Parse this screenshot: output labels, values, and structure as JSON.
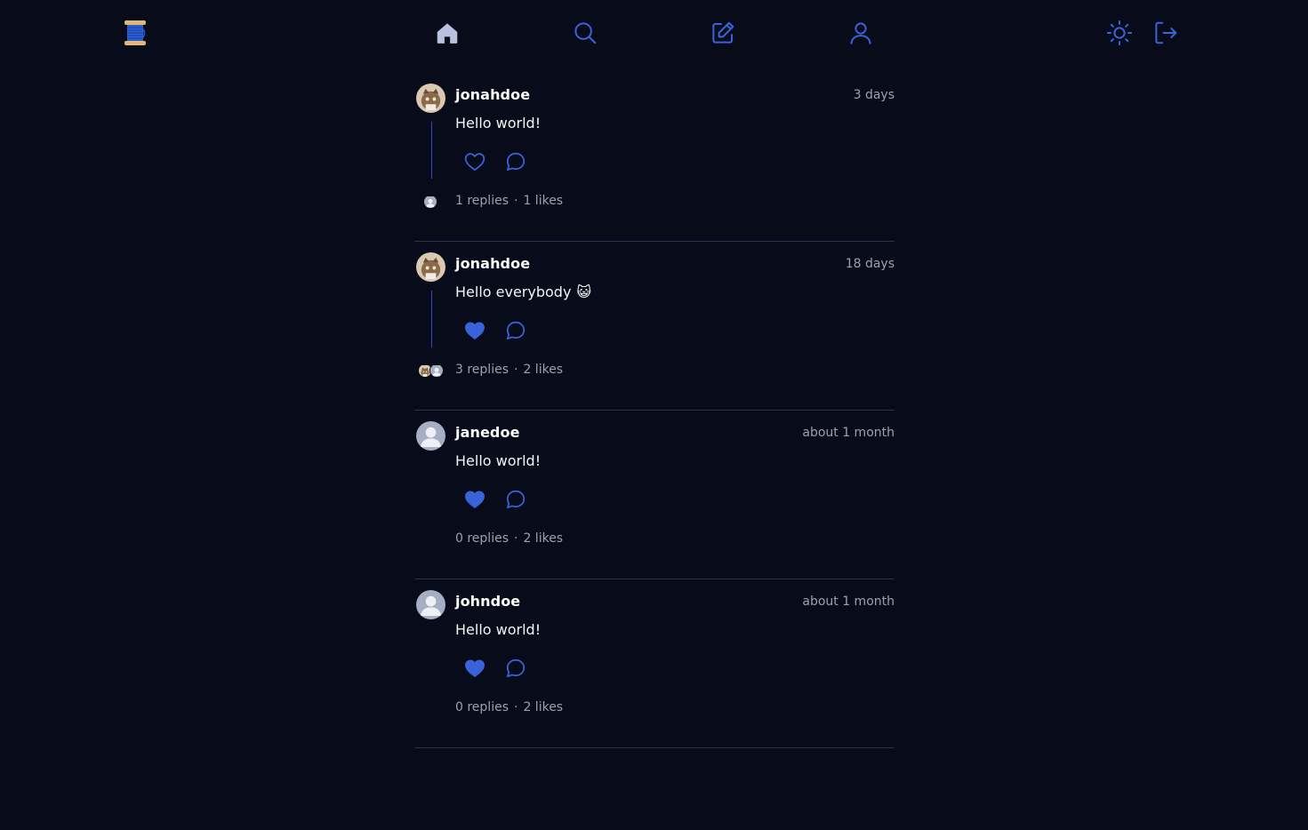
{
  "app": {
    "logo_icon": "thread-spool-icon"
  },
  "nav": {
    "items": [
      {
        "name": "home",
        "icon": "home-icon",
        "color": "#b9c2dd"
      },
      {
        "name": "search",
        "icon": "search-icon",
        "color": "#3b63d9"
      },
      {
        "name": "create",
        "icon": "edit-icon",
        "color": "#3b63d9"
      },
      {
        "name": "profile",
        "icon": "user-icon",
        "color": "#3b63d9"
      }
    ],
    "right": [
      {
        "name": "theme-toggle",
        "icon": "sun-icon"
      },
      {
        "name": "logout",
        "icon": "logout-icon"
      }
    ],
    "accent": "#3b63d9"
  },
  "posts": [
    {
      "username": "jonahdoe",
      "time": "3 days",
      "text": "Hello world!",
      "emoji": "",
      "liked": false,
      "replies": "1 replies",
      "likes": "1 likes",
      "avatar": "cat-avatar"
    },
    {
      "username": "jonahdoe",
      "time": "18 days",
      "text": "Hello everybody",
      "emoji": "😺",
      "liked": true,
      "replies": "3 replies",
      "likes": "2 likes",
      "avatar": "cat-avatar"
    },
    {
      "username": "janedoe",
      "time": "about 1 month",
      "text": "Hello world!",
      "emoji": "",
      "liked": true,
      "replies": "0 replies",
      "likes": "2 likes",
      "avatar": "default-avatar"
    },
    {
      "username": "johndoe",
      "time": "about 1 month",
      "text": "Hello world!",
      "emoji": "",
      "liked": true,
      "replies": "0 replies",
      "likes": "2 likes",
      "avatar": "default-avatar"
    }
  ],
  "separator": "·"
}
